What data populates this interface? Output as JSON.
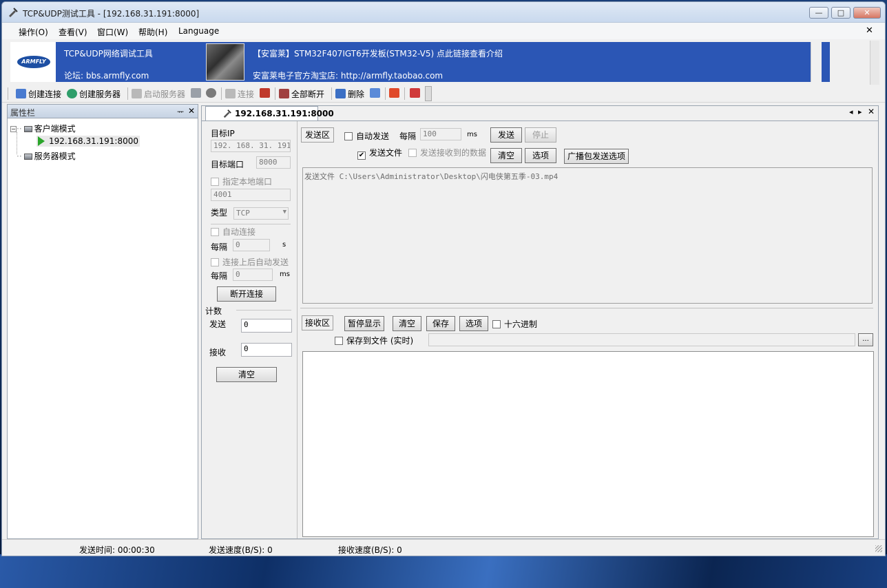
{
  "window": {
    "title": "TCP&UDP测试工具 - [192.168.31.191:8000]",
    "controls": {
      "minimize": "—",
      "maximize": "□",
      "close": "✕"
    }
  },
  "menu": {
    "items": [
      "操作(O)",
      "查看(V)",
      "窗口(W)",
      "帮助(H)",
      "Language"
    ],
    "mdi_close": "✕"
  },
  "banner": {
    "logo_text": "ARMFLY",
    "line1_left": "TCP&UDP网络调试工具",
    "line2_left": "论坛: bbs.armfly.com",
    "line1_right": "【安富莱】STM32F407IGT6开发板(STM32-V5) 点此链接查看介绍",
    "line2_right": "安富莱电子官方淘宝店: http://armfly.taobao.com"
  },
  "toolbar": {
    "create_connection": "创建连接",
    "create_server": "创建服务器",
    "start_server": "启动服务器",
    "connect": "连接",
    "disconnect_all": "全部断开",
    "delete": "删除"
  },
  "left_panel": {
    "title": "属性栏",
    "pin": "ᅲ",
    "close": "✕",
    "tree": {
      "client_mode": "客户端模式",
      "client_item": "192.168.31.191:8000",
      "server_mode": "服务器模式"
    }
  },
  "tab": {
    "label": "192.168.31.191:8000",
    "nav_prev": "◂",
    "nav_next": "▸",
    "close": "✕"
  },
  "connection": {
    "target_ip_label": "目标IP",
    "target_ip": "192. 168. 31. 191",
    "target_port_label": "目标端口",
    "target_port": "8000",
    "local_port_label": "指定本地端口",
    "local_port": "4001",
    "type_label": "类型",
    "type_value": "TCP",
    "auto_connect_label": "自动连接",
    "interval_label": "每隔",
    "interval_value": "0",
    "interval_unit": "s",
    "auto_send_label": "连接上后自动发送",
    "interval2_label": "每隔",
    "interval2_value": "0",
    "interval2_unit": "ms",
    "disconnect_button": "断开连接",
    "count_title": "计数",
    "sent_label": "发送",
    "sent_value": "0",
    "recv_label": "接收",
    "recv_value": "0",
    "clear_button": "清空"
  },
  "send_area": {
    "title": "发送区",
    "auto_send_label": "自动发送",
    "interval_label": "每隔",
    "interval_value": "100",
    "interval_unit": "ms",
    "send_button": "发送",
    "stop_button": "停止",
    "send_file_label": "发送文件",
    "send_file_checked": "✔",
    "send_received_label": "发送接收到的数据",
    "clear_button": "清空",
    "options_button": "选项",
    "broadcast_button": "广播包发送选项",
    "content": "发送文件 C:\\Users\\Administrator\\Desktop\\闪电侠第五季-03.mp4"
  },
  "recv_area": {
    "title": "接收区",
    "pause_button": "暂停显示",
    "clear_button": "清空",
    "save_button": "保存",
    "options_button": "选项",
    "hex_label": "十六进制",
    "save_to_file_label": "保存到文件 (实时)",
    "browse_button": "...",
    "file_path": ""
  },
  "status": {
    "send_time": "发送时间: 00:00:30",
    "send_speed": "发送速度(B/S): 0",
    "recv_speed": "接收速度(B/S): 0"
  },
  "colors": {
    "banner_bg": "#2b56b5",
    "play_icon": "#2aa52a"
  }
}
